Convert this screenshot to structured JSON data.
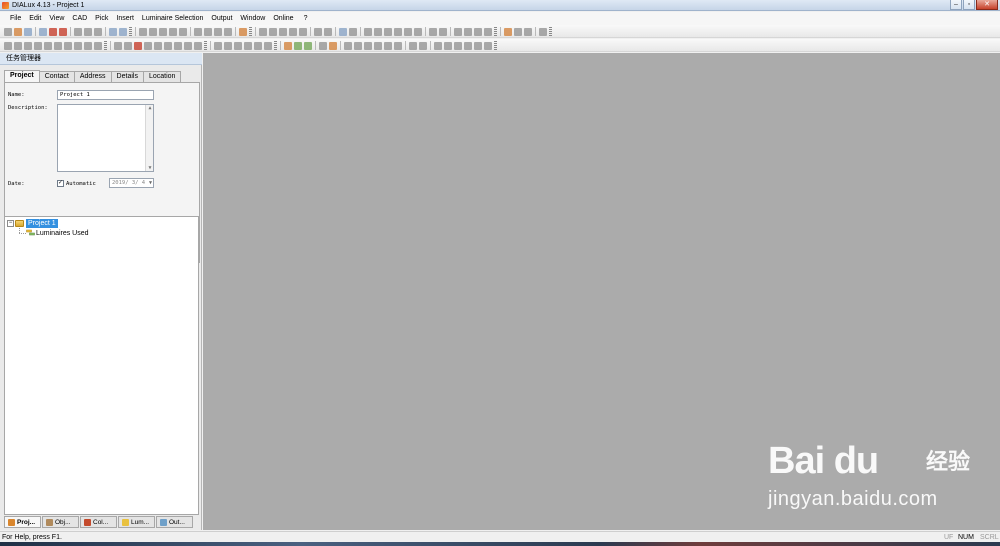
{
  "window": {
    "title": "DIALux 4.13 - Project 1"
  },
  "menu": [
    "File",
    "Edit",
    "View",
    "CAD",
    "Pick",
    "Insert",
    "Luminaire Selection",
    "Output",
    "Window",
    "Online",
    "?"
  ],
  "panel": {
    "title": "任务管理器",
    "tabs": [
      "Project",
      "Contact",
      "Address",
      "Details",
      "Location"
    ],
    "form": {
      "name_label": "Name:",
      "name_value": "Project 1",
      "description_label": "Description:",
      "description_value": "",
      "date_label": "Date:",
      "automatic_label": "Automatic",
      "automatic_checked": true,
      "date_value": "2019/ 3/ 4"
    },
    "tree": {
      "root": "Project 1",
      "child": "Luminaires Used"
    },
    "bottom_tabs": [
      "Proj...",
      "Obj...",
      "Col...",
      "Lum...",
      "Out..."
    ]
  },
  "watermark": {
    "logo": "Bai du",
    "cn": "经验",
    "url": "jingyan.baidu.com"
  },
  "status": {
    "help_text": "For Help, press F1.",
    "indicators": [
      "UF",
      "NUM",
      "SCRL"
    ]
  },
  "icons": {
    "app": "dialux-app-icon",
    "check": "✓",
    "expander": "−"
  }
}
